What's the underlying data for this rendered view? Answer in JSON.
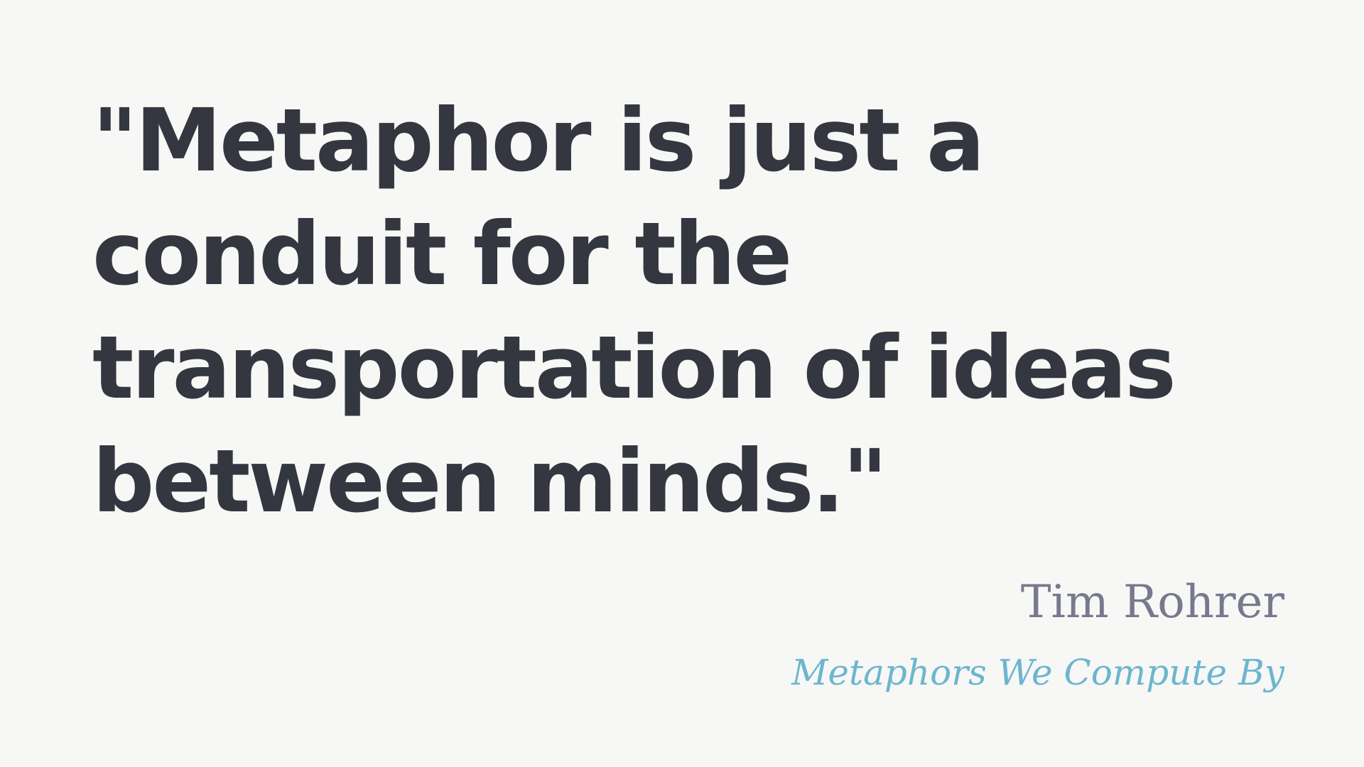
{
  "quote": {
    "text": "\"Metaphor is just a conduit for the transportation of ideas between minds.\""
  },
  "attribution": {
    "author": "Tim Rohrer",
    "source": "Metaphors We Compute By"
  },
  "colors": {
    "background": "#f7f7f5",
    "quote_text": "#343640",
    "author_text": "#77798d",
    "source_text": "#6bb6cf"
  }
}
